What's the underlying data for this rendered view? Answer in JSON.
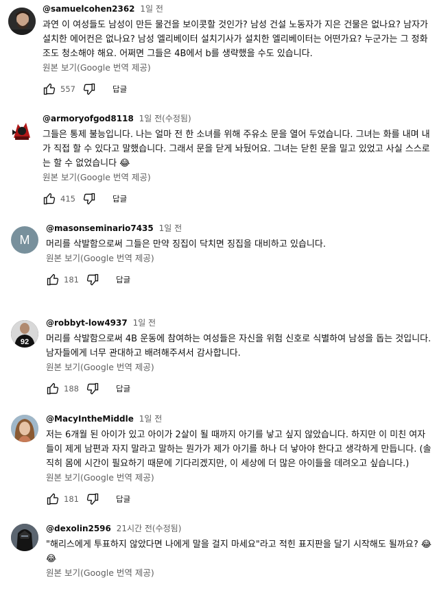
{
  "comments": [
    {
      "author": "@samuelcohen2362",
      "time": "1일 전",
      "text": "과연 이 여성들도 남성이 만든 물건을 보이콧할 것인가? 남성 건설 노동자가 지은 건물은 없나요? 남자가 설치한 에어컨은 없나요? 남성 엘리베이터 설치기사가 설치한 엘리베이터는 어떤가요? 누군가는 그 정화조도 청소해야 해요. 어쩌면 그들은 4B에서 b를 생략했을 수도 있습니다.",
      "translate": "원본 보기(Google 번역 제공)",
      "likes": "557",
      "reply": "답글"
    },
    {
      "author": "@armoryofgod8118",
      "time": "1일 전(수정됨)",
      "text": "그들은 통제 불능입니다. 나는 얼마 전 한 소녀를 위해 주유소 문을 열어 두었습니다. 그녀는 화를 내며 내가 직접 할 수 있다고 말했습니다. 그래서 문을 닫게 놔뒀어요. 그녀는 닫힌 문을 밀고 있었고 사실 스스로는 할 수 없었습니다 😂",
      "translate": "원본 보기(Google 번역 제공)",
      "likes": "415",
      "reply": "답글"
    },
    {
      "author": "@masonseminario7435",
      "time": "1일 전",
      "avatar_letter": "M",
      "text": "머리를 삭발함으로써 그들은 만약 징집이 닥치면 징집을 대비하고 있습니다.",
      "translate": "원본 보기(Google 번역 제공)",
      "likes": "181",
      "reply": "답글"
    },
    {
      "author": "@robbyt-low4937",
      "time": "1일 전",
      "avatar_text": "92",
      "text": "머리를 삭발함으로써 4B 운동에 참여하는 여성들은 자신을 위험 신호로 식별하여 남성을 돕는 것입니다. 남자들에게 너무 관대하고 배려해주셔서 감사합니다.",
      "translate": "원본 보기(Google 번역 제공)",
      "likes": "188",
      "reply": "답글"
    },
    {
      "author": "@MacyIntheMiddle",
      "time": "1일 전",
      "text": "저는 6개월 된 아이가 있고 아이가 2살이 될 때까지 아기를 낳고 싶지 않았습니다. 하지만 이 미친 여자들이 제게 남편과 자지 말라고 말하는 뭔가가 제가 아기를 하나 더 낳아야 한다고 생각하게 만듭니다. (솔직히 몸에 시간이 필요하기 때문에 기다리겠지만, 이 세상에 더 많은 아이들을 데려오고 싶습니다.)",
      "translate": "원본 보기(Google 번역 제공)",
      "likes": "181",
      "reply": "답글"
    },
    {
      "author": "@dexolin2596",
      "time": "21시간 전(수정됨)",
      "text": "\"해리스에게 투표하지 않았다면 나에게 말을 걸지 마세요\"라고 적힌 표지판을 달기 시작해도 될까요? 😂 😂",
      "translate": "원본 보기(Google 번역 제공)"
    }
  ]
}
